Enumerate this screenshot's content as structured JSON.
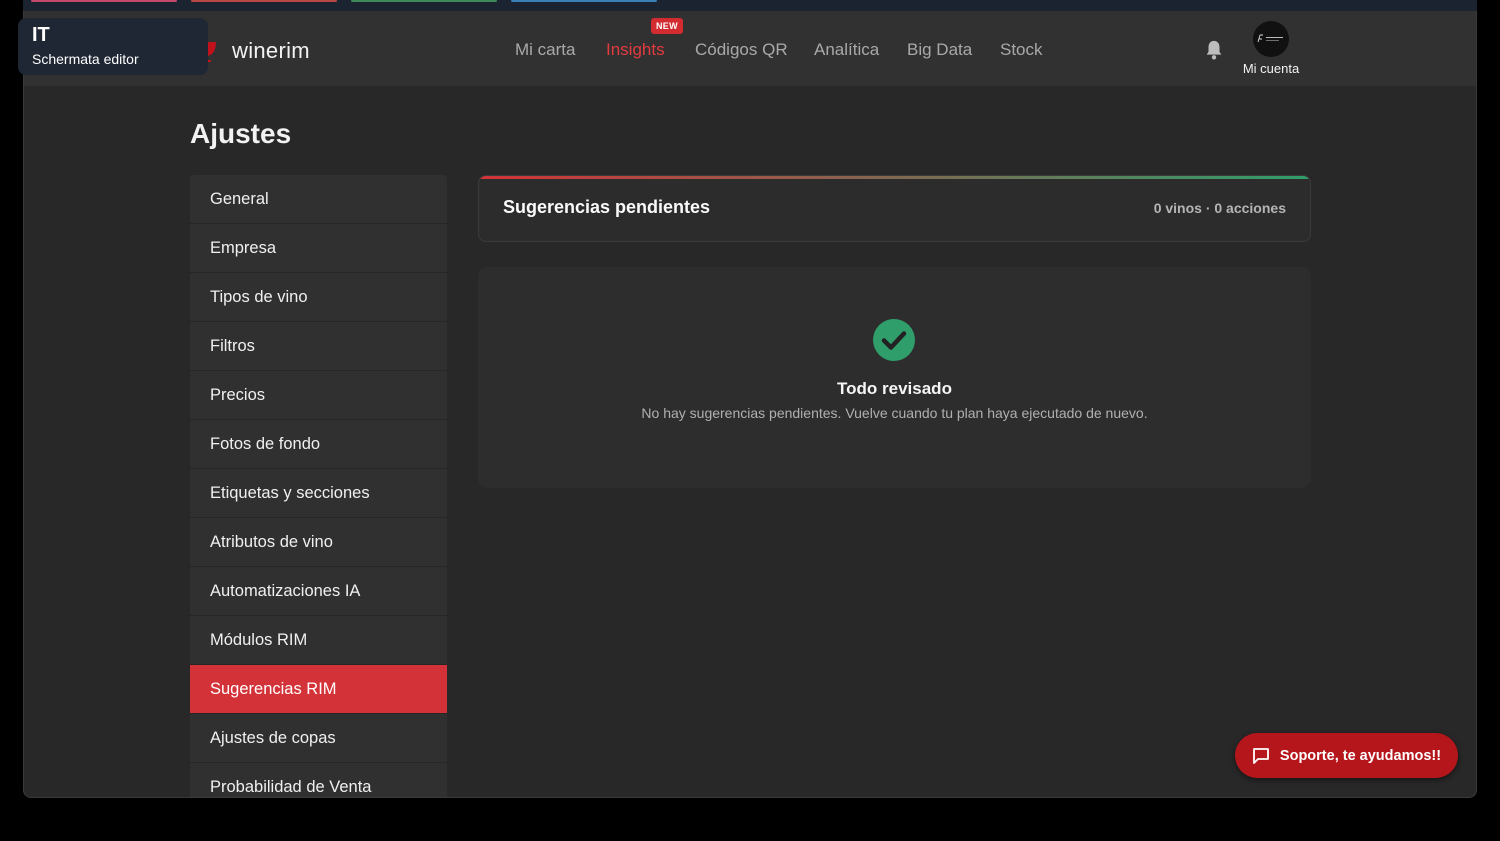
{
  "editor_badge": {
    "code": "IT",
    "label": "Schermata editor"
  },
  "brand": {
    "name": "winerim"
  },
  "nav": {
    "items": [
      {
        "label": "Mi carta"
      },
      {
        "label": "Insights",
        "badge": "NEW"
      },
      {
        "label": "Códigos QR"
      },
      {
        "label": "Analítica"
      },
      {
        "label": "Big Data"
      },
      {
        "label": "Stock"
      }
    ],
    "active_index": 1
  },
  "account": {
    "label": "Mi cuenta"
  },
  "page": {
    "title": "Ajustes"
  },
  "settings_menu": {
    "items": [
      "General",
      "Empresa",
      "Tipos de vino",
      "Filtros",
      "Precios",
      "Fotos de fondo",
      "Etiquetas y secciones",
      "Atributos de vino",
      "Automatizaciones IA",
      "Módulos RIM",
      "Sugerencias RIM",
      "Ajustes de copas",
      "Probabilidad de Venta"
    ],
    "active_index": 10
  },
  "pending": {
    "title": "Sugerencias pendientes",
    "counts": "0 vinos · 0 acciones"
  },
  "empty_state": {
    "title": "Todo revisado",
    "text": "No hay sugerencias pendientes. Vuelve cuando tu plan haya ejecutado de nuevo."
  },
  "support": {
    "label": "Soporte, te ayudamos!!"
  },
  "icons": {
    "bell": "bell-icon",
    "check": "check-circle-icon",
    "chat": "chat-bubble-icon",
    "brand": "wine-logo-icon"
  },
  "colors": {
    "accent": "#d33338",
    "success": "#2f9e6a",
    "support": "#b5161c",
    "badge": "#d22b30"
  }
}
